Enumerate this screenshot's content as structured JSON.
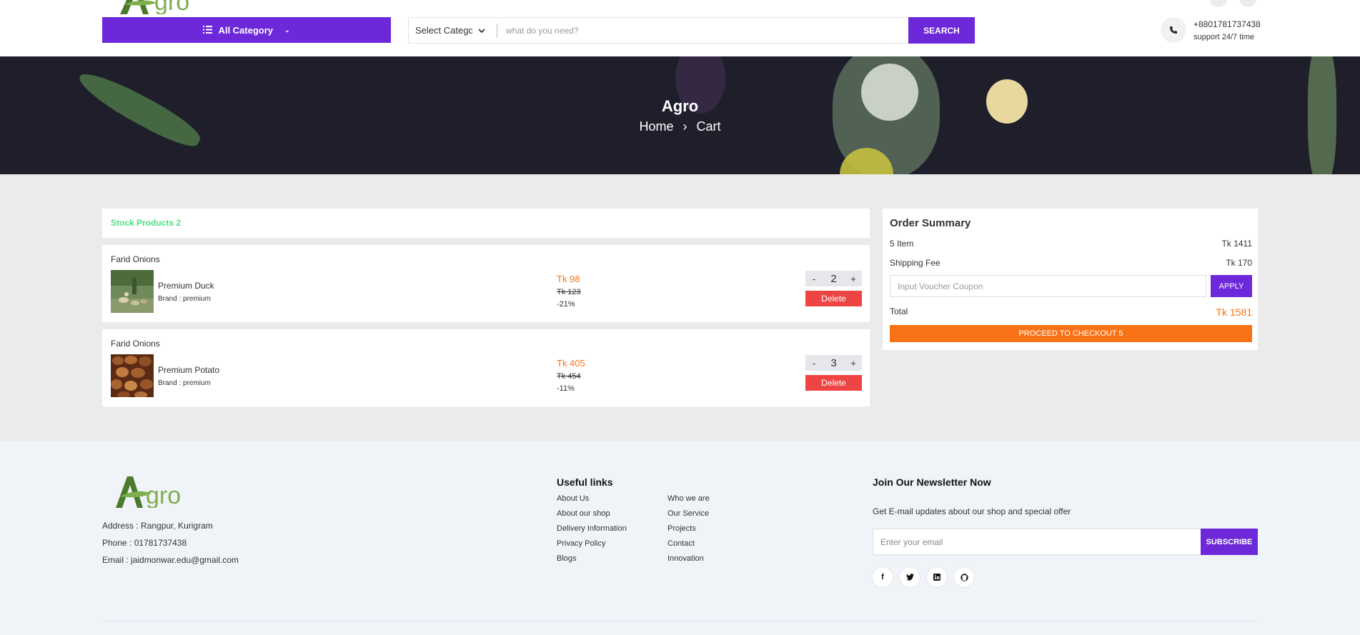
{
  "header": {
    "all_category_label": "All Category",
    "select_category_label": "Select Category",
    "search_placeholder": "what do you need?",
    "search_button": "SEARCH",
    "phone": "+8801781737438",
    "support": "support 24/7 time"
  },
  "hero": {
    "title": "Agro",
    "breadcrumb_home": "Home",
    "breadcrumb_sep": "›",
    "breadcrumb_current": "Cart"
  },
  "cart": {
    "stock_label": "Stock Products 2",
    "items": [
      {
        "shop": "Farid Onions",
        "name": "Premium Duck",
        "brand": "Brand : premium",
        "price": "Tk 98",
        "old_price": "Tk 123",
        "discount": "-21%",
        "qty": "2",
        "minus": "-",
        "plus": "+",
        "delete_label": "Delete"
      },
      {
        "shop": "Farid Onions",
        "name": "Premium Potato",
        "brand": "Brand : premium",
        "price": "Tk 405",
        "old_price": "Tk 454",
        "discount": "-11%",
        "qty": "3",
        "minus": "-",
        "plus": "+",
        "delete_label": "Delete"
      }
    ]
  },
  "summary": {
    "title": "Order Summary",
    "items_label": "5 Item",
    "items_value": "Tk 1411",
    "shipping_label": "Shipping Fee",
    "shipping_value": "Tk 170",
    "voucher_placeholder": "Input Voucher Coupon",
    "apply_label": "APPLY",
    "total_label": "Total",
    "total_value": "Tk 1581",
    "checkout_label": "PROCEED TO CHECKOUT 5"
  },
  "footer": {
    "logo_text": "Agro",
    "address": "Address : Rangpur, Kurigram",
    "phone": "Phone : 01781737438",
    "email": "Email : jaidmonwar.edu@gmail.com",
    "links_title": "Useful links",
    "links_col1": [
      "About Us",
      "About our shop",
      "Delivery Information",
      "Privacy Policy",
      "Blogs"
    ],
    "links_col2": [
      "Who we are",
      "Our Service",
      "Projects",
      "Contact",
      "Innovation"
    ],
    "newsletter_title": "Join Our Newsletter Now",
    "newsletter_sub": "Get E-mail updates about our shop and special offer",
    "email_placeholder": "Enter your email",
    "subscribe_label": "SUBSCRIBE",
    "social_icons": [
      "facebook-icon",
      "twitter-icon",
      "linkedin-icon",
      "github-icon"
    ]
  },
  "colors": {
    "primary": "#6d28d9",
    "accent": "#f97316",
    "danger": "#ef4444",
    "success": "#4ade80",
    "logo_green": "#6a9b3a"
  }
}
